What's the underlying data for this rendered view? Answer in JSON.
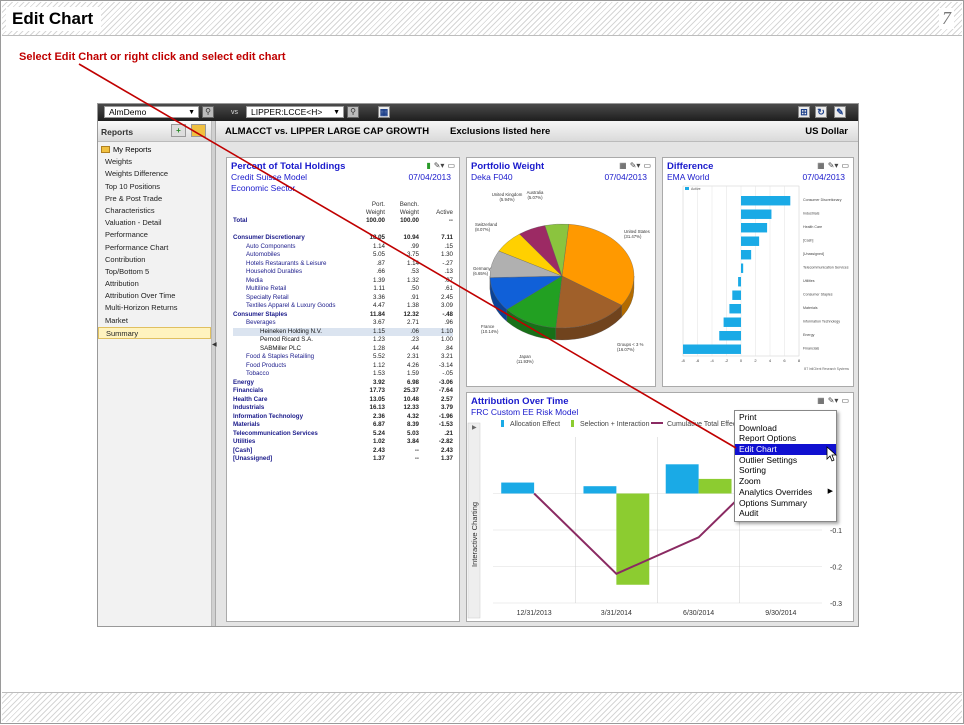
{
  "slide": {
    "title": "Edit Chart",
    "page_number": "7",
    "instruction": "Select Edit Chart or right click and select edit chart"
  },
  "toolbar": {
    "portfolio_select": "AlmDemo",
    "vs_label": "vs",
    "benchmark_select": "LIPPER:LCCE<H>"
  },
  "header": {
    "comparison": "ALMACCT vs. LIPPER LARGE CAP GROWTH",
    "exclusions": "Exclusions listed here",
    "currency": "US Dollar"
  },
  "sidebar": {
    "heading": "Reports",
    "folder": "My Reports",
    "items": [
      "Weights",
      "Weights Difference",
      "Top 10 Positions",
      "Pre & Post Trade",
      "Characteristics",
      "Valuation - Detail",
      "Performance",
      "Performance Chart",
      "Contribution",
      "Top/Bottom 5",
      "Attribution",
      "Attribution Over Time",
      "Multi-Horizon Returns",
      "Market",
      "Summary"
    ],
    "selected": "Summary"
  },
  "holdings": {
    "title": "Percent of Total Holdings",
    "subtitle1": "Credit Suisse Model",
    "subtitle2": "Economic Sector",
    "date": "07/04/2013",
    "col_headers": [
      [
        "Port.",
        "Weight"
      ],
      [
        "Bench.",
        "Weight"
      ],
      [
        "",
        "Active"
      ]
    ],
    "rows": [
      {
        "name": "Total",
        "p": "100.00",
        "b": "100.00",
        "a": "--",
        "lvl": "b"
      },
      {
        "name": "",
        "p": "",
        "b": "",
        "a": "",
        "lvl": "sp"
      },
      {
        "name": "Consumer Discretionary",
        "p": "18.05",
        "b": "10.94",
        "a": "7.11",
        "lvl": "b"
      },
      {
        "name": "Auto Components",
        "p": "1.14",
        "b": ".99",
        "a": ".15",
        "lvl": "l1"
      },
      {
        "name": "Automobiles",
        "p": "5.05",
        "b": "3.75",
        "a": "1.30",
        "lvl": "l1"
      },
      {
        "name": "Hotels Restaurants & Leisure",
        "p": ".87",
        "b": "1.14",
        "a": "-.27",
        "lvl": "l1"
      },
      {
        "name": "Household Durables",
        "p": ".66",
        "b": ".53",
        "a": ".13",
        "lvl": "l1"
      },
      {
        "name": "Media",
        "p": "1.39",
        "b": "1.32",
        "a": ".07",
        "lvl": "l1"
      },
      {
        "name": "Multiline Retail",
        "p": "1.11",
        "b": ".50",
        "a": ".61",
        "lvl": "l1"
      },
      {
        "name": "Specialty Retail",
        "p": "3.36",
        "b": ".91",
        "a": "2.45",
        "lvl": "l1"
      },
      {
        "name": "Textiles Apparel & Luxury Goods",
        "p": "4.47",
        "b": "1.38",
        "a": "3.09",
        "lvl": "l1"
      },
      {
        "name": "Consumer Staples",
        "p": "11.84",
        "b": "12.32",
        "a": "-.48",
        "lvl": "b"
      },
      {
        "name": "Beverages",
        "p": "3.67",
        "b": "2.71",
        "a": ".96",
        "lvl": "l1"
      },
      {
        "name": "Heineken Holding N.V.",
        "p": "1.15",
        "b": ".06",
        "a": "1.10",
        "lvl": "l2 hl"
      },
      {
        "name": "Pernod Ricard S.A.",
        "p": "1.23",
        "b": ".23",
        "a": "1.00",
        "lvl": "l2"
      },
      {
        "name": "SABMiller PLC",
        "p": "1.28",
        "b": ".44",
        "a": ".84",
        "lvl": "l2"
      },
      {
        "name": "Food & Staples Retailing",
        "p": "5.52",
        "b": "2.31",
        "a": "3.21",
        "lvl": "l1"
      },
      {
        "name": "Food Products",
        "p": "1.12",
        "b": "4.26",
        "a": "-3.14",
        "lvl": "l1"
      },
      {
        "name": "Tobacco",
        "p": "1.53",
        "b": "1.59",
        "a": "-.05",
        "lvl": "l1"
      },
      {
        "name": "Energy",
        "p": "3.92",
        "b": "6.98",
        "a": "-3.06",
        "lvl": "b"
      },
      {
        "name": "Financials",
        "p": "17.73",
        "b": "25.37",
        "a": "-7.64",
        "lvl": "b"
      },
      {
        "name": "Health Care",
        "p": "13.05",
        "b": "10.48",
        "a": "2.57",
        "lvl": "b"
      },
      {
        "name": "Industrials",
        "p": "16.13",
        "b": "12.33",
        "a": "3.79",
        "lvl": "b"
      },
      {
        "name": "Information Technology",
        "p": "2.36",
        "b": "4.32",
        "a": "-1.96",
        "lvl": "b"
      },
      {
        "name": "Materials",
        "p": "6.87",
        "b": "8.39",
        "a": "-1.53",
        "lvl": "b"
      },
      {
        "name": "Telecommunication Services",
        "p": "5.24",
        "b": "5.03",
        "a": ".21",
        "lvl": "b"
      },
      {
        "name": "Utilities",
        "p": "1.02",
        "b": "3.84",
        "a": "-2.82",
        "lvl": "b"
      },
      {
        "name": "[Cash]",
        "p": "2.43",
        "b": "--",
        "a": "2.43",
        "lvl": "b"
      },
      {
        "name": "[Unassigned]",
        "p": "1.37",
        "b": "--",
        "a": "1.37",
        "lvl": "b"
      }
    ]
  },
  "portfolio_weight": {
    "title": "Portfolio Weight",
    "subtitle": "Deka F040",
    "date": "07/04/2013",
    "slice_colors": [
      "#ff9900",
      "#a0602a",
      "#22a022",
      "#1060d8",
      "#b0b0b0",
      "#ffd000",
      "#9c2a64",
      "#8bc43e"
    ],
    "labels": [
      "United States (31.47%)",
      "Groups < 3 % (16.07%)",
      "Japan (11.93%)",
      "France (10.14%)",
      "Switzerland (8.07%)",
      "Germany (6.65%)",
      "United Kingdom (5.94%)",
      "Australia (5.07%)"
    ]
  },
  "difference": {
    "title": "Difference",
    "subtitle": "EMA World",
    "date": "07/04/2013",
    "legend": "Active",
    "categories": [
      "Consumer Discretionary",
      "Industrials",
      "Health Care",
      "[Cash]",
      "[Unassigned]",
      "Telecommunication Services",
      "Utilities",
      "Consumer Staples",
      "Materials",
      "Information Technology",
      "Energy",
      "Financials"
    ],
    "xticks": [
      "-8",
      "-6",
      "-4",
      "-2",
      "0",
      "2",
      "4",
      "6",
      "8"
    ],
    "footer": "BT IntlClient Research Systems"
  },
  "chart_data": {
    "type": "bar",
    "title": "Attribution Over Time",
    "subtitle": "FRC Custom EE Risk Model",
    "categories": [
      "12/31/2013",
      "3/31/2014",
      "6/30/2014",
      "9/30/2014"
    ],
    "series": [
      {
        "name": "Allocation Effect",
        "type": "bar",
        "values": [
          0.03,
          0.02,
          0.08,
          0.01
        ]
      },
      {
        "name": "Selection + Interaction",
        "type": "bar",
        "values": [
          null,
          -0.25,
          0.04,
          0.1
        ]
      },
      {
        "name": "Cumulative Total Effect",
        "type": "line",
        "values": [
          0.0,
          -0.22,
          -0.12,
          0.1
        ]
      }
    ],
    "ylim": [
      -0.3,
      0.1
    ],
    "yticks": [
      "0",
      "-0.1",
      "-0.2",
      "-0.3"
    ],
    "side_label": "Interactive Charting",
    "colors": {
      "allocation": "#1aaae6",
      "selection": "#8ccc30",
      "cumulative": "#8a2a62"
    }
  },
  "context_menu": {
    "items": [
      "Print",
      "Download",
      "Report Options",
      "Edit Chart",
      "Outlier Settings",
      "Sorting",
      "Zoom",
      "Analytics Overrides",
      "Options Summary",
      "Audit"
    ],
    "active": "Edit Chart",
    "has_submenu": "Analytics Overrides"
  },
  "colors": {
    "annotation_line": "#c00000",
    "link_blue": "#1a1acc"
  }
}
